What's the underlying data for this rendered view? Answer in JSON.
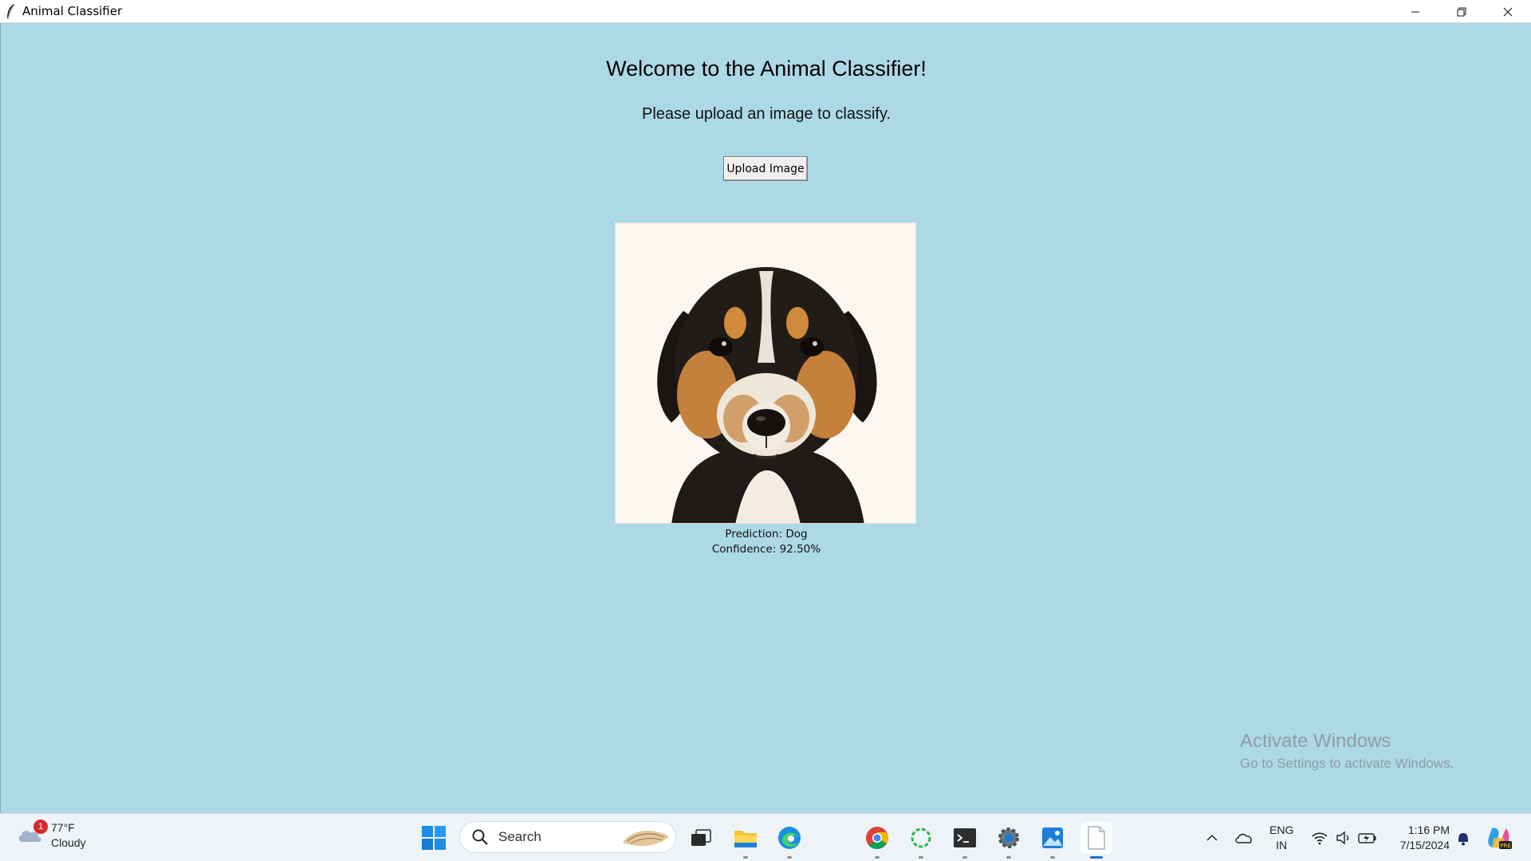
{
  "window": {
    "title": "Animal Classifier",
    "controls": {
      "minimize": "—",
      "restore": "❐",
      "close": "✕"
    }
  },
  "app": {
    "heading": "Welcome to the Animal Classifier!",
    "subtext": "Please upload an image to classify.",
    "upload_button": "Upload Image",
    "image_subject": "puppy-photo",
    "prediction": "Prediction: Dog",
    "confidence": "Confidence: 92.50%"
  },
  "watermark": {
    "line1": "Activate Windows",
    "line2": "Go to Settings to activate Windows."
  },
  "taskbar": {
    "weather": {
      "temp": "77°F",
      "condition": "Cloudy",
      "badge": "1"
    },
    "search_placeholder": "Search",
    "apps": [
      "task-view",
      "file-explorer",
      "edge",
      "chrome",
      "loading-app",
      "terminal",
      "settings",
      "photos",
      "notepad"
    ],
    "language": {
      "line1": "ENG",
      "line2": "IN"
    },
    "clock": {
      "time": "1:16 PM",
      "date": "7/15/2024"
    }
  },
  "colors": {
    "background": "#add8e6",
    "accent": "#1f6fd1"
  }
}
